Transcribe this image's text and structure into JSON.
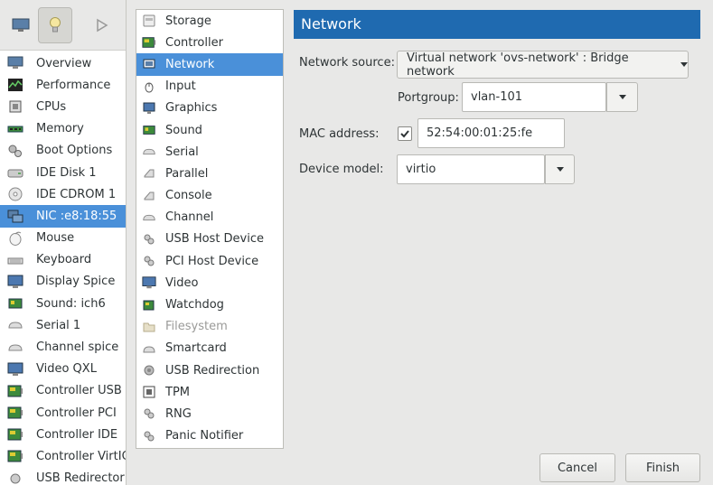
{
  "toolbar": {
    "icons": [
      "monitor-icon",
      "lightbulb-icon",
      "play-icon"
    ]
  },
  "hardware_list": [
    {
      "label": "Overview",
      "icon": "monitor-icon"
    },
    {
      "label": "Performance",
      "icon": "performance-icon"
    },
    {
      "label": "CPUs",
      "icon": "cpu-icon"
    },
    {
      "label": "Memory",
      "icon": "memory-icon"
    },
    {
      "label": "Boot Options",
      "icon": "gears-icon"
    },
    {
      "label": "IDE Disk 1",
      "icon": "disk-icon"
    },
    {
      "label": "IDE CDROM 1",
      "icon": "cdrom-icon"
    },
    {
      "label": "NIC :e8:18:55",
      "icon": "nic-icon",
      "selected": true
    },
    {
      "label": "Mouse",
      "icon": "mouse-icon"
    },
    {
      "label": "Keyboard",
      "icon": "keyboard-icon"
    },
    {
      "label": "Display Spice",
      "icon": "display-icon"
    },
    {
      "label": "Sound: ich6",
      "icon": "sound-icon"
    },
    {
      "label": "Serial 1",
      "icon": "serial-icon"
    },
    {
      "label": "Channel spice",
      "icon": "channel-icon"
    },
    {
      "label": "Video QXL",
      "icon": "video-icon"
    },
    {
      "label": "Controller USB",
      "icon": "controller-icon"
    },
    {
      "label": "Controller PCI",
      "icon": "controller-icon"
    },
    {
      "label": "Controller IDE",
      "icon": "controller-icon"
    },
    {
      "label": "Controller VirtIO",
      "icon": "controller-icon"
    },
    {
      "label": "USB Redirector",
      "icon": "usb-redirect-icon"
    }
  ],
  "device_types": [
    {
      "label": "Storage",
      "icon": "storage-icon"
    },
    {
      "label": "Controller",
      "icon": "controller-icon"
    },
    {
      "label": "Network",
      "icon": "network-icon",
      "selected": true
    },
    {
      "label": "Input",
      "icon": "input-icon"
    },
    {
      "label": "Graphics",
      "icon": "graphics-icon"
    },
    {
      "label": "Sound",
      "icon": "sound-icon"
    },
    {
      "label": "Serial",
      "icon": "serial-icon"
    },
    {
      "label": "Parallel",
      "icon": "parallel-icon"
    },
    {
      "label": "Console",
      "icon": "console-icon"
    },
    {
      "label": "Channel",
      "icon": "channel-icon"
    },
    {
      "label": "USB Host Device",
      "icon": "usb-icon"
    },
    {
      "label": "PCI Host Device",
      "icon": "pci-icon"
    },
    {
      "label": "Video",
      "icon": "video-icon"
    },
    {
      "label": "Watchdog",
      "icon": "watchdog-icon"
    },
    {
      "label": "Filesystem",
      "icon": "folder-icon",
      "disabled": true
    },
    {
      "label": "Smartcard",
      "icon": "smartcard-icon"
    },
    {
      "label": "USB Redirection",
      "icon": "usb-redirection-icon"
    },
    {
      "label": "TPM",
      "icon": "tpm-icon"
    },
    {
      "label": "RNG",
      "icon": "rng-icon"
    },
    {
      "label": "Panic Notifier",
      "icon": "panic-icon"
    }
  ],
  "panel": {
    "title": "Network",
    "network_source_label": "Network source:",
    "network_source_value": "Virtual network 'ovs-network' : Bridge network",
    "portgroup_label": "Portgroup:",
    "portgroup_value": "vlan-101",
    "mac_label": "MAC address:",
    "mac_checked": true,
    "mac_value": "52:54:00:01:25:fe",
    "device_model_label": "Device model:",
    "device_model_value": "virtio"
  },
  "buttons": {
    "cancel": "Cancel",
    "finish": "Finish"
  },
  "colors": {
    "selection": "#4a90d9",
    "header": "#1f6ab0"
  }
}
